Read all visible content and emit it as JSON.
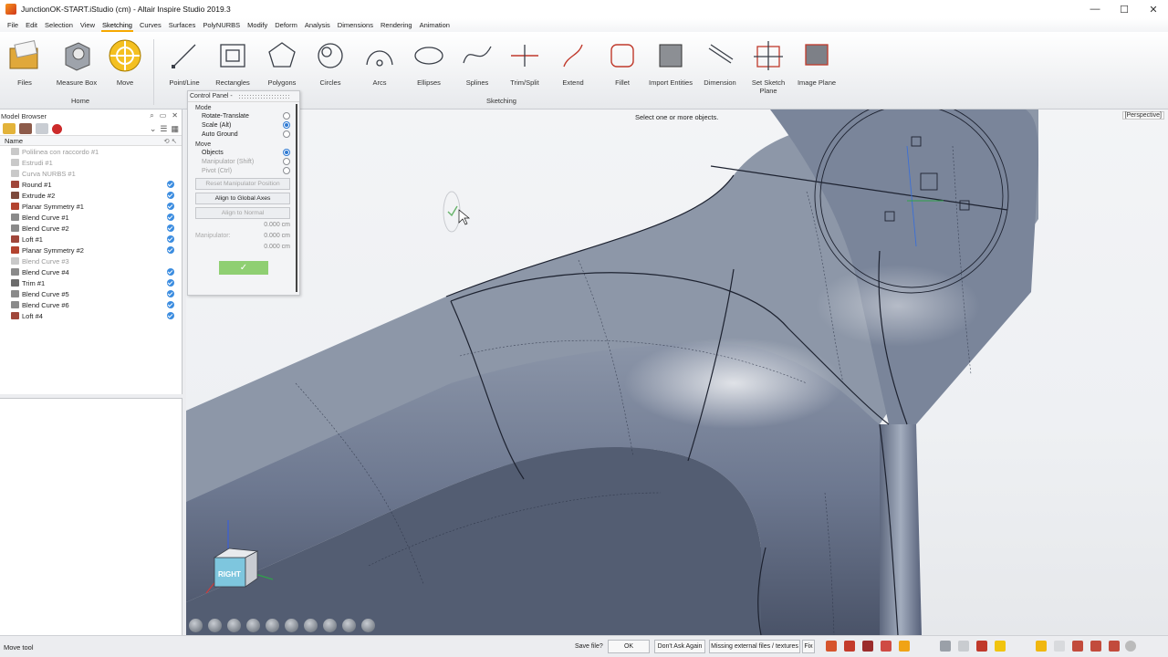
{
  "window": {
    "title": "JunctionOK-START.iStudio (cm) - Altair Inspire Studio 2019.3",
    "minimize": "—",
    "maximize": "☐",
    "close": "✕"
  },
  "menu": [
    "File",
    "Edit",
    "Selection",
    "View",
    "Sketching",
    "Curves",
    "Surfaces",
    "PolyNURBS",
    "Modify",
    "Deform",
    "Analysis",
    "Dimensions",
    "Rendering",
    "Animation"
  ],
  "menu_active": "Sketching",
  "ribbon": {
    "home_label": "Home",
    "sketching_label": "Sketching",
    "tools": [
      {
        "label": "Files",
        "icon": "folder-icon"
      },
      {
        "label": "Measure Box",
        "icon": "measure-box-icon"
      },
      {
        "label": "Move",
        "icon": "move-icon"
      },
      {
        "label": "Point/Line",
        "icon": "point-line-icon"
      },
      {
        "label": "Rectangles",
        "icon": "rectangles-icon"
      },
      {
        "label": "Polygons",
        "icon": "polygons-icon"
      },
      {
        "label": "Circles",
        "icon": "circles-icon"
      },
      {
        "label": "Arcs",
        "icon": "arcs-icon"
      },
      {
        "label": "Ellipses",
        "icon": "ellipses-icon"
      },
      {
        "label": "Splines",
        "icon": "splines-icon"
      },
      {
        "label": "Trim/Split",
        "icon": "trim-split-icon"
      },
      {
        "label": "Extend",
        "icon": "extend-icon"
      },
      {
        "label": "Fillet",
        "icon": "fillet-icon"
      },
      {
        "label": "Import Entities",
        "icon": "import-entities-icon"
      },
      {
        "label": "Dimension",
        "icon": "dimension-icon"
      },
      {
        "label": "Set Sketch Plane",
        "icon": "sketch-plane-icon"
      },
      {
        "label": "Image Plane",
        "icon": "image-plane-icon"
      }
    ]
  },
  "model_browser": {
    "title": "Model Browser",
    "column_name": "Name",
    "items": [
      {
        "label": "Polilinea con raccordo #1",
        "dim": true,
        "visible": false
      },
      {
        "label": "Estrudi #1",
        "dim": true,
        "visible": false
      },
      {
        "label": "Curva NURBS #1",
        "dim": true,
        "visible": false
      },
      {
        "label": "Round #1",
        "dim": false,
        "visible": true
      },
      {
        "label": "Extrude #2",
        "dim": false,
        "visible": true
      },
      {
        "label": "Planar Symmetry #1",
        "dim": false,
        "visible": true
      },
      {
        "label": "Blend Curve #1",
        "dim": false,
        "visible": true
      },
      {
        "label": "Blend Curve #2",
        "dim": false,
        "visible": true
      },
      {
        "label": "Loft #1",
        "dim": false,
        "visible": true
      },
      {
        "label": "Planar Symmetry #2",
        "dim": false,
        "visible": true
      },
      {
        "label": "Blend Curve #3",
        "dim": true,
        "visible": false
      },
      {
        "label": "Blend Curve #4",
        "dim": false,
        "visible": true
      },
      {
        "label": "Trim #1",
        "dim": false,
        "visible": true
      },
      {
        "label": "Blend Curve #5",
        "dim": false,
        "visible": true
      },
      {
        "label": "Blend Curve #6",
        "dim": false,
        "visible": true
      },
      {
        "label": "Loft #4",
        "dim": false,
        "visible": true
      }
    ]
  },
  "control_panel": {
    "title": "Control Panel -",
    "mode_label": "Mode",
    "mode_options": [
      {
        "label": "Rotate-Translate",
        "selected": false,
        "dim": false
      },
      {
        "label": "Scale (Alt)",
        "selected": true,
        "dim": false
      },
      {
        "label": "Auto Ground",
        "selected": false,
        "dim": false
      }
    ],
    "move_label": "Move",
    "move_options": [
      {
        "label": "Objects",
        "selected": true,
        "dim": false
      },
      {
        "label": "Manipulator (Shift)",
        "selected": false,
        "dim": true
      },
      {
        "label": "Pivot (Ctrl)",
        "selected": false,
        "dim": true
      }
    ],
    "reset_button": "Reset Manipulator Position",
    "align_global_button": "Align to Global Axes",
    "align_normal_button": "Align to Normal",
    "value1": "0.000 cm",
    "manipulator_label": "Manipulator:",
    "value2": "0.000 cm",
    "value3": "0.000 cm",
    "ok_symbol": "✓"
  },
  "viewport": {
    "hint": "Select one or more objects.",
    "projection": "[Perspective]",
    "cube_label": "RIGHT"
  },
  "status": {
    "text": "Move tool",
    "save_prompt": "Save file?",
    "ok": "OK",
    "dont_ask": "Don't Ask Again",
    "missing": "Missing external files / textures",
    "fix": "Fix"
  }
}
